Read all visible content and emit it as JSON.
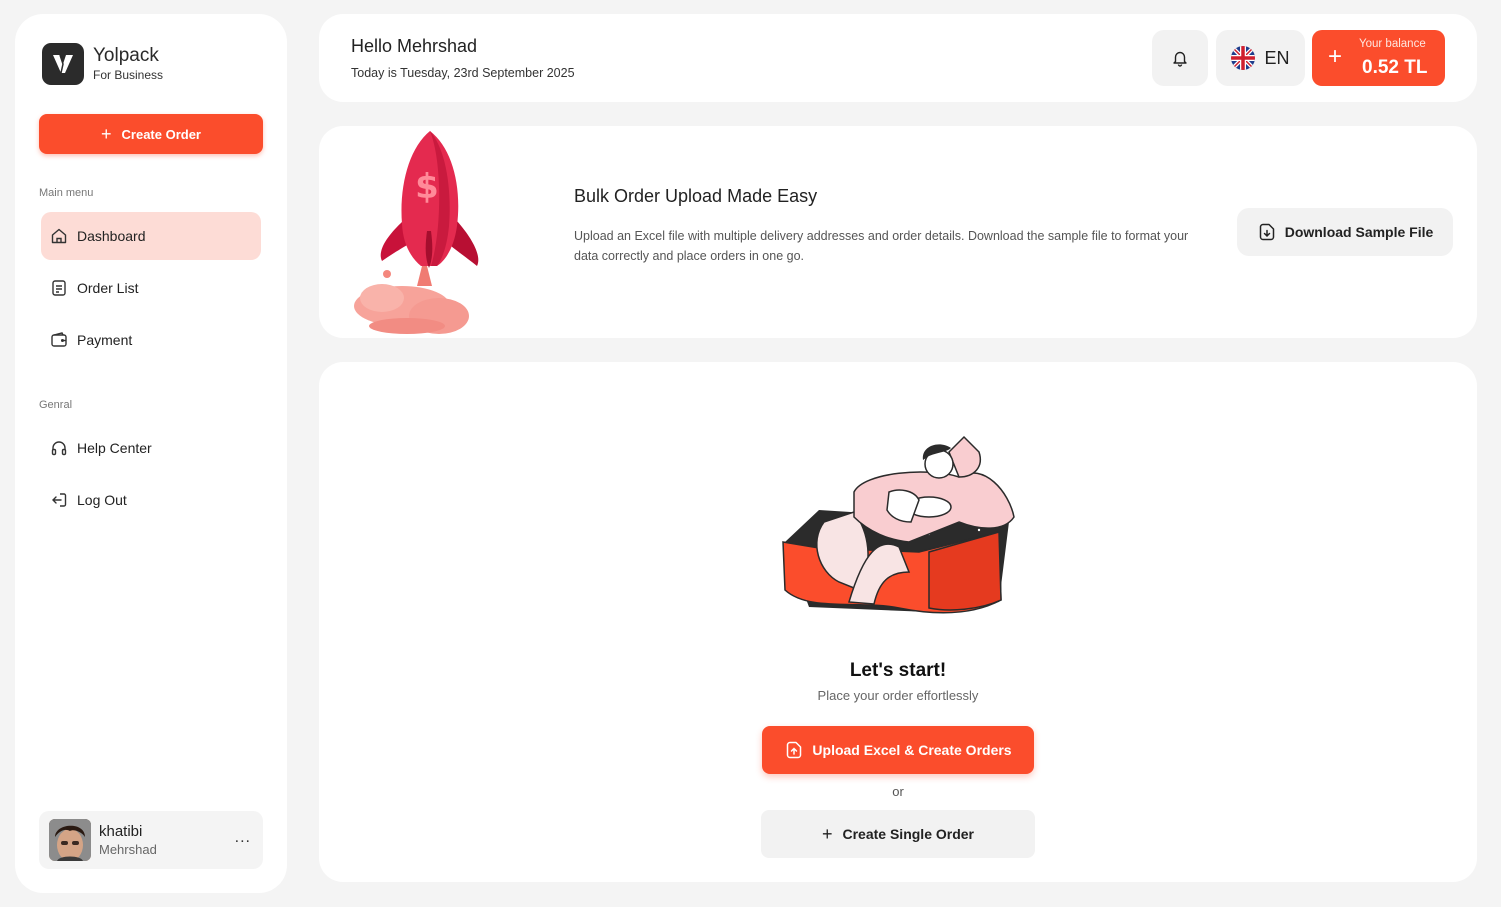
{
  "brand": {
    "name": "Yolpack",
    "subtitle": "For Business"
  },
  "sidebar": {
    "create_label": "Create Order",
    "main_menu_label": "Main menu",
    "general_label": "Genral",
    "main_items": [
      {
        "label": "Dashboard",
        "icon": "home-icon",
        "active": true
      },
      {
        "label": "Order List",
        "icon": "document-icon",
        "active": false
      },
      {
        "label": "Payment",
        "icon": "wallet-icon",
        "active": false
      }
    ],
    "general_items": [
      {
        "label": "Help Center",
        "icon": "headset-icon"
      },
      {
        "label": "Log Out",
        "icon": "logout-icon"
      }
    ],
    "user": {
      "name": "khatibi",
      "subname": "Mehrshad",
      "more": "..."
    }
  },
  "header": {
    "greeting": "Hello Mehrshad",
    "date": "Today is Tuesday, 23rd September 2025",
    "language": "EN",
    "balance_label": "Your balance",
    "balance_value": "0.52 TL"
  },
  "banner": {
    "title": "Bulk Order Upload Made Easy",
    "description": "Upload an Excel file with multiple delivery addresses and order details. Download the sample file to format your data correctly and place orders in one go.",
    "download_label": "Download Sample File"
  },
  "main": {
    "title": "Let's start!",
    "subtitle": "Place your order effortlessly",
    "upload_label": "Upload Excel & Create Orders",
    "or_label": "or",
    "single_label": "Create Single Order"
  },
  "colors": {
    "accent": "#fb4d2c",
    "active_bg": "#fddcd6",
    "page_bg": "#f4f4f4"
  }
}
